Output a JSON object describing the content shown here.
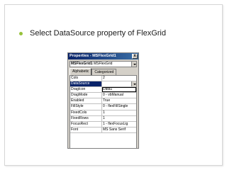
{
  "slide": {
    "bullet_text": "Select DataSource property of FlexGrid",
    "bullet_color": "#97c23b"
  },
  "properties_window": {
    "title": "Properties - MSFlexGrid1",
    "close_label": "x",
    "object_combo": {
      "name": "MSFlexGrid1",
      "type": "MSFlexGrid"
    },
    "tabs": [
      "Alphabetic",
      "Categorized"
    ],
    "active_tab": "Alphabetic",
    "rows": [
      {
        "name": "Cols",
        "value": "2"
      },
      {
        "name": "DataSource",
        "value": ""
      },
      {
        "name": "DragIcon",
        "value": "Data1"
      },
      {
        "name": "DragMode",
        "value": "0 - vbManual"
      },
      {
        "name": "Enabled",
        "value": "True"
      },
      {
        "name": "FillStyle",
        "value": "0 - flexFillSingle"
      },
      {
        "name": "FixedCols",
        "value": "1"
      },
      {
        "name": "FixedRows",
        "value": "1"
      },
      {
        "name": "FocusRect",
        "value": "1 - flexFocusLig"
      },
      {
        "name": "Font",
        "value": "MS Sans Serif"
      }
    ]
  }
}
